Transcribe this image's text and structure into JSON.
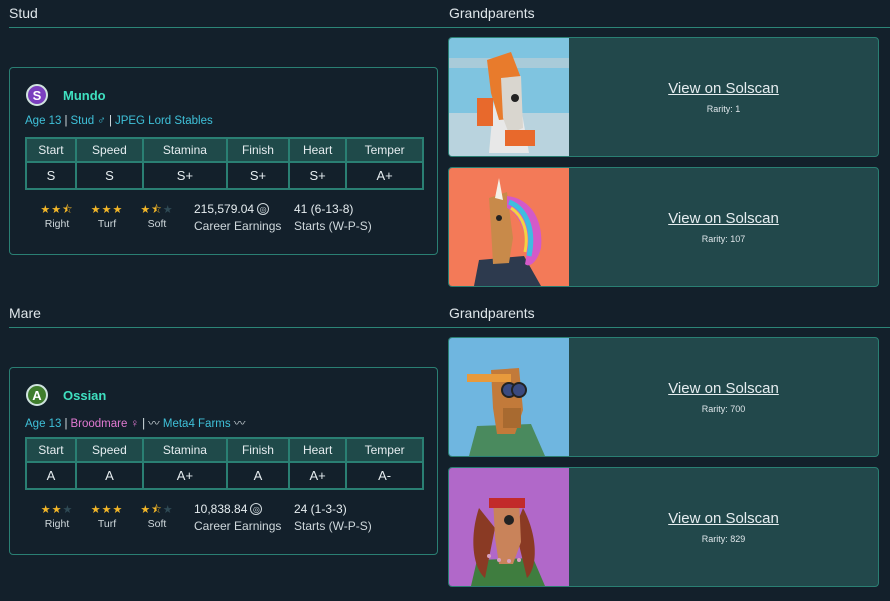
{
  "sections": {
    "stud_title": "Stud",
    "mare_title": "Mare",
    "grandparents_title": "Grandparents"
  },
  "stud": {
    "avatar_letter": "S",
    "name": "Mundo",
    "age": "Age 13",
    "role": "Stud ♂",
    "stable": "JPEG Lord Stables",
    "stat_headers": [
      "Start",
      "Speed",
      "Stamina",
      "Finish",
      "Heart",
      "Temper"
    ],
    "stat_values": [
      "S",
      "S",
      "S+",
      "S+",
      "S+",
      "A+"
    ],
    "ratings": [
      {
        "label": "Right",
        "stars": 2.5
      },
      {
        "label": "Turf",
        "stars": 3
      },
      {
        "label": "Soft",
        "stars": 1.5
      }
    ],
    "earnings": "215,579.04",
    "earnings_label": "Career Earnings",
    "starts": "41 (6-13-8)",
    "starts_label": "Starts (W-P-S)"
  },
  "mare": {
    "avatar_letter": "A",
    "name": "Ossian",
    "age": "Age 13",
    "role": "Broodmare ♀",
    "stable": "Meta4 Farms",
    "stat_headers": [
      "Start",
      "Speed",
      "Stamina",
      "Finish",
      "Heart",
      "Temper"
    ],
    "stat_values": [
      "A",
      "A",
      "A+",
      "A",
      "A+",
      "A-"
    ],
    "ratings": [
      {
        "label": "Right",
        "stars": 2
      },
      {
        "label": "Turf",
        "stars": 3
      },
      {
        "label": "Soft",
        "stars": 1.5
      }
    ],
    "earnings": "10,838.84",
    "earnings_label": "Career Earnings",
    "starts": "24 (1-3-3)",
    "starts_label": "Starts (W-P-S)"
  },
  "grandparents": [
    {
      "link": "View on Solscan",
      "rarity": "Rarity: 1"
    },
    {
      "link": "View on Solscan",
      "rarity": "Rarity: 107"
    },
    {
      "link": "View on Solscan",
      "rarity": "Rarity: 700"
    },
    {
      "link": "View on Solscan",
      "rarity": "Rarity: 829"
    }
  ],
  "colors": {
    "accent": "#3fe0c0",
    "stud_meta": "#3fc1d9",
    "mare_meta": "#e17ad2",
    "border": "#2a7f73",
    "star": "#f4b728"
  }
}
